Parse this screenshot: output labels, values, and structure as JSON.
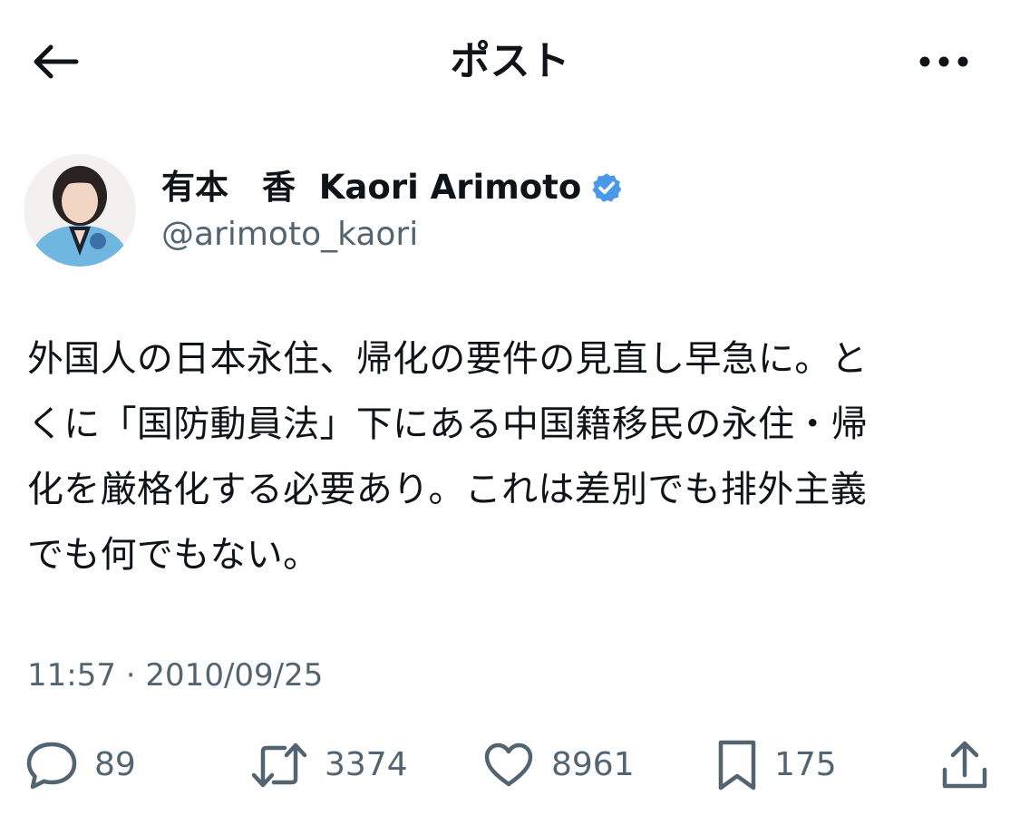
{
  "header": {
    "title": "ポスト",
    "back_icon": "back-arrow-icon",
    "more_icon": "more-options-icon"
  },
  "author": {
    "display_name": "有本　香  Kaori Arimoto",
    "handle": "@arimoto_kaori",
    "verified": true,
    "verified_icon": "verified-badge-icon",
    "verified_color": "#4a99e9"
  },
  "post": {
    "text": "外国人の日本永住、帰化の要件の見直し早急に。と\nくに「国防動員法」下にある中国籍移民の永住・帰\n化を厳格化する必要あり。これは差別でも排外主義\nでも何でもない。"
  },
  "timestamp": {
    "time": "11:57",
    "separator": "·",
    "date": "2010/09/25"
  },
  "actions": {
    "replies": {
      "icon": "reply-icon",
      "count": "89"
    },
    "reposts": {
      "icon": "repost-icon",
      "count": "3374"
    },
    "likes": {
      "icon": "like-icon",
      "count": "8961"
    },
    "bookmarks": {
      "icon": "bookmark-icon",
      "count": "175"
    },
    "share": {
      "icon": "share-icon"
    }
  },
  "colors": {
    "text_primary": "#0f1419",
    "text_secondary": "#536471",
    "verified_blue": "#4a99e9"
  }
}
